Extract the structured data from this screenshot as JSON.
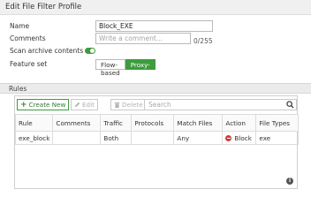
{
  "window": {
    "title": "Edit File Filter Profile"
  },
  "form": {
    "name": {
      "label": "Name",
      "value": "Block_EXE"
    },
    "comments": {
      "label": "Comments",
      "placeholder": "Write a comment...",
      "counter": "0/255"
    },
    "scan_archive": {
      "label": "Scan archive contents",
      "enabled": true
    },
    "feature_set": {
      "label": "Feature set",
      "options": [
        "Flow-based",
        "Proxy-based"
      ],
      "selected": "Proxy-based"
    }
  },
  "rules": {
    "section_title": "Rules",
    "toolbar": {
      "create_label": "Create New",
      "edit_label": "Edit",
      "delete_label": "Delete",
      "search_placeholder": "Search"
    },
    "columns": [
      "Rule",
      "Comments",
      "Traffic",
      "Protocols",
      "Match Files",
      "Action",
      "File Types"
    ],
    "rows": [
      {
        "rule": "exe_block",
        "comments": "",
        "traffic": "Both",
        "protocols": "",
        "match_files": "Any",
        "action": "Block",
        "file_types": "exe"
      }
    ]
  },
  "colors": {
    "accent_green": "#3e9b3e",
    "block_red": "#d23a3a"
  }
}
